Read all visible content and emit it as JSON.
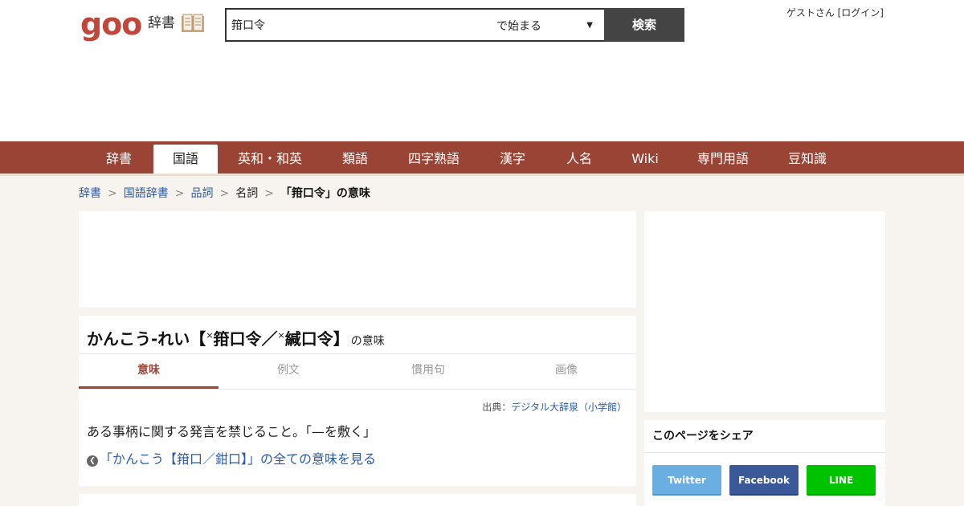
{
  "header": {
    "logo": "goo",
    "dict_label": "辞書",
    "search_value": "箝口令",
    "search_mode": "で始まる",
    "search_button": "検索",
    "user": "ゲストさん [ログイン]"
  },
  "nav": {
    "tabs": [
      {
        "label": "辞書"
      },
      {
        "label": "国語"
      },
      {
        "label": "英和・和英"
      },
      {
        "label": "類語"
      },
      {
        "label": "四字熟語"
      },
      {
        "label": "漢字"
      },
      {
        "label": "人名"
      },
      {
        "label": "Wiki"
      },
      {
        "label": "専門用語"
      },
      {
        "label": "豆知識"
      }
    ],
    "active": "国語"
  },
  "breadcrumb": {
    "items": [
      "辞書",
      "国語辞書",
      "品詞"
    ],
    "current": "名詞",
    "page": "「箝口令」の意味"
  },
  "entry": {
    "reading": "かんこう-れい【",
    "mark1": "×",
    "kanji1": "箝口令／",
    "mark2": "×",
    "kanji2": "緘口令",
    "close": "】",
    "suffix": "の意味",
    "tabs": [
      "意味",
      "例文",
      "慣用句",
      "画像"
    ],
    "active_tab": "意味",
    "source_label": "出典：",
    "source_link": "デジタル大辞泉（小学館）",
    "definition": "ある事柄に関する発言を禁じること。「—を敷く」",
    "more_link": "「かんこう【箝口／鉗口】」の全ての意味を見る"
  },
  "share": {
    "title": "このページをシェア",
    "buttons": [
      {
        "label": "Twitter",
        "color": "#6aaee2"
      },
      {
        "label": "Facebook",
        "color": "#3b5998"
      },
      {
        "label": "LINE",
        "color": "#00c300"
      }
    ]
  },
  "colors": {
    "brand": "#c1463b",
    "nav": "#994434",
    "link": "#2a5aa8"
  }
}
